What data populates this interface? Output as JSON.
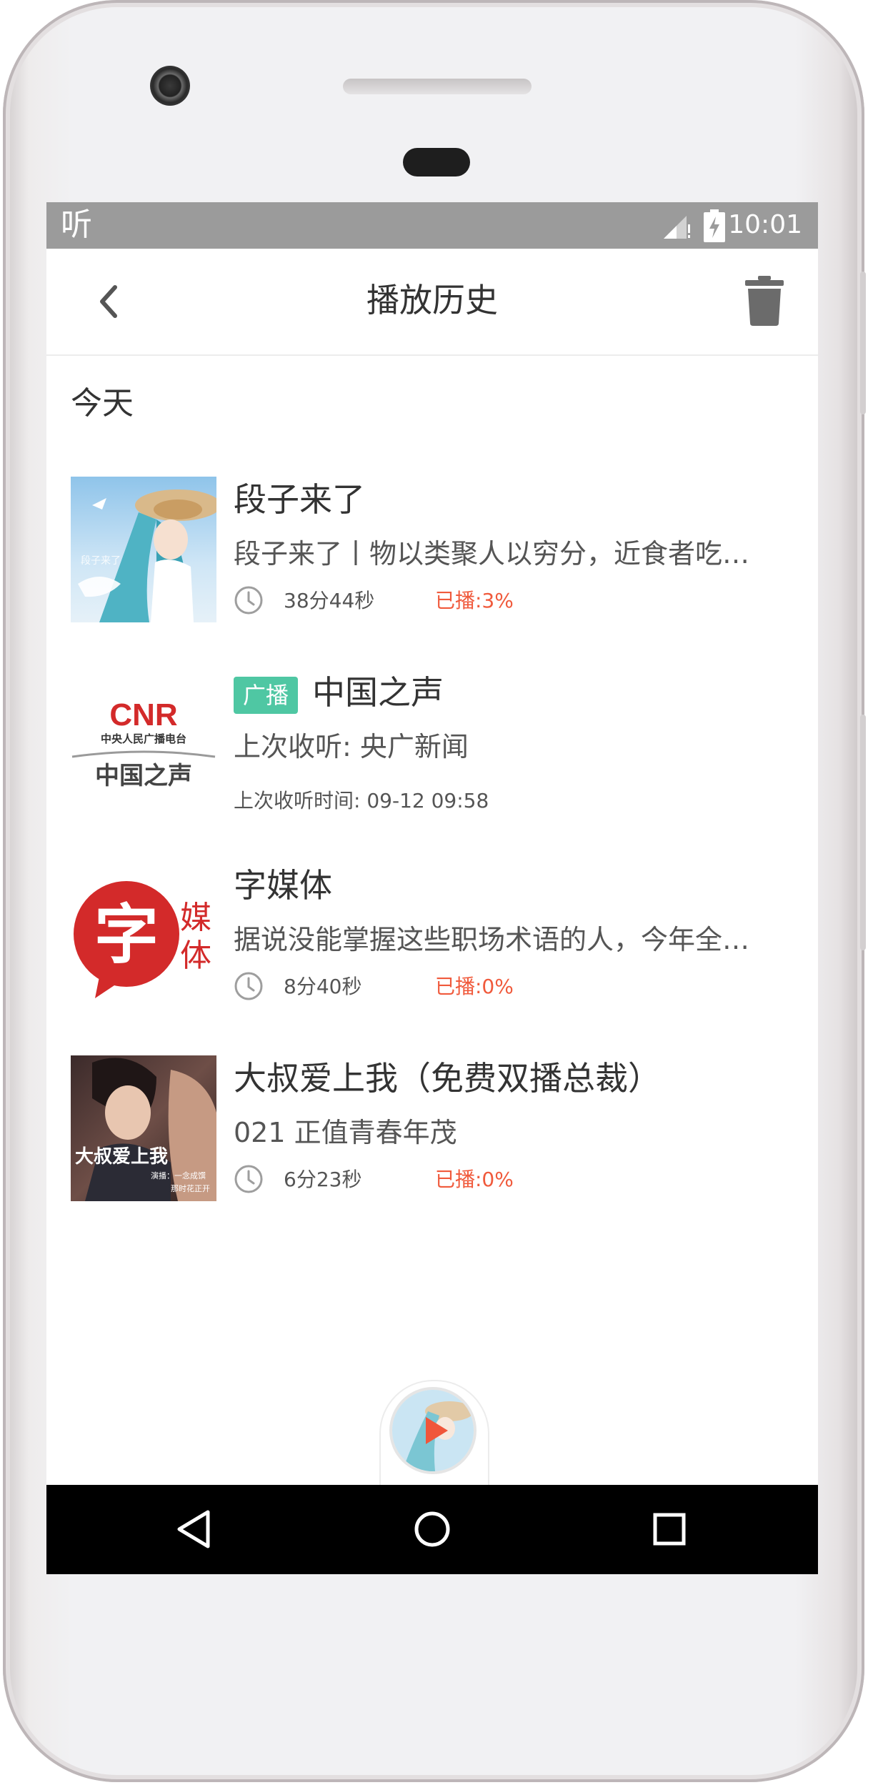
{
  "status_bar": {
    "app_glyph": "听",
    "time": "10:01"
  },
  "header": {
    "title": "播放历史"
  },
  "section": {
    "label": "今天"
  },
  "items": [
    {
      "title": "段子来了",
      "desc": "段子来了丨物以类聚人以穷分，近食者吃…",
      "duration": "38分44秒",
      "progress": "已播:3%"
    },
    {
      "badge": "广播",
      "title": "中国之声",
      "desc": "上次收听: 央广新闻",
      "last_time": "上次收听时间: 09-12 09:58",
      "cover": {
        "line1": "CNR",
        "line2": "中央人民广播电台",
        "line3": "中国之声"
      }
    },
    {
      "title": "字媒体",
      "desc": "据说没能掌握这些职场术语的人，今年全…",
      "duration": "8分40秒",
      "progress": "已播:0%",
      "cover": {
        "main": "字",
        "side": "媒体"
      }
    },
    {
      "title": "大叔爱上我（免费双播总裁）",
      "desc": "021 正值青春年茂",
      "duration": "6分23秒",
      "progress": "已播:0%",
      "cover": {
        "caption": "大叔爱上我",
        "sub1": "演播：一念成馔",
        "sub2": "那时花正开"
      }
    }
  ],
  "colors": {
    "accent_green": "#4fc7a3",
    "progress_red": "#f05a3c",
    "cnr_red": "#d32a2a",
    "status_bar": "#9b9b9b"
  },
  "icons": [
    "back-arrow-icon",
    "trash-icon",
    "clock-icon",
    "play-icon",
    "nav-back-icon",
    "nav-home-icon",
    "nav-recents-icon",
    "signal-icon",
    "battery-icon"
  ]
}
